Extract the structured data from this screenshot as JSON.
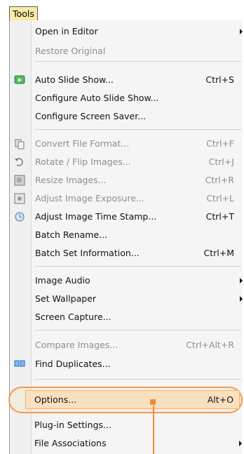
{
  "menu": {
    "title": "Tools",
    "items": [
      {
        "label": "Open in Editor",
        "has_submenu": true,
        "disabled": false
      },
      {
        "label": "Restore Original",
        "disabled": true
      },
      {
        "label": "Auto Slide Show...",
        "shortcut": "Ctrl+S",
        "icon": "slideshow-icon",
        "disabled": false
      },
      {
        "label": "Configure Auto Slide Show...",
        "disabled": false
      },
      {
        "label": "Configure Screen Saver...",
        "disabled": false
      },
      {
        "label": "Convert File Format...",
        "shortcut": "Ctrl+F",
        "icon": "convert-icon",
        "disabled": true
      },
      {
        "label": "Rotate / Flip Images...",
        "shortcut": "Ctrl+J",
        "icon": "rotate-icon",
        "disabled": true
      },
      {
        "label": "Resize Images...",
        "shortcut": "Ctrl+R",
        "icon": "resize-icon",
        "disabled": true
      },
      {
        "label": "Adjust Image Exposure...",
        "shortcut": "Ctrl+L",
        "icon": "exposure-icon",
        "disabled": true
      },
      {
        "label": "Adjust Image Time Stamp...",
        "shortcut": "Ctrl+T",
        "icon": "timestamp-icon",
        "disabled": false
      },
      {
        "label": "Batch Rename...",
        "disabled": false
      },
      {
        "label": "Batch Set Information...",
        "shortcut": "Ctrl+M",
        "disabled": false
      },
      {
        "label": "Image Audio",
        "has_submenu": true,
        "disabled": false
      },
      {
        "label": "Set Wallpaper",
        "has_submenu": true,
        "disabled": false
      },
      {
        "label": "Screen Capture...",
        "disabled": false
      },
      {
        "label": "Compare Images...",
        "shortcut": "Ctrl+Alt+R",
        "disabled": true
      },
      {
        "label": "Find Duplicates...",
        "icon": "duplicates-icon",
        "disabled": false
      },
      {
        "label": "Options...",
        "shortcut": "Alt+O",
        "highlighted": true,
        "disabled": false
      },
      {
        "label": "Plug-in Settings...",
        "disabled": false
      },
      {
        "label": "File Associations",
        "has_submenu": true,
        "disabled": false
      }
    ]
  },
  "colors": {
    "tab_bg": "#f7eca6",
    "panel_bg": "#f5f5f5",
    "disabled_text": "#8e8e8e",
    "highlight_bg": "#f9e1bf",
    "annotation_orange": "#f28a3c"
  }
}
